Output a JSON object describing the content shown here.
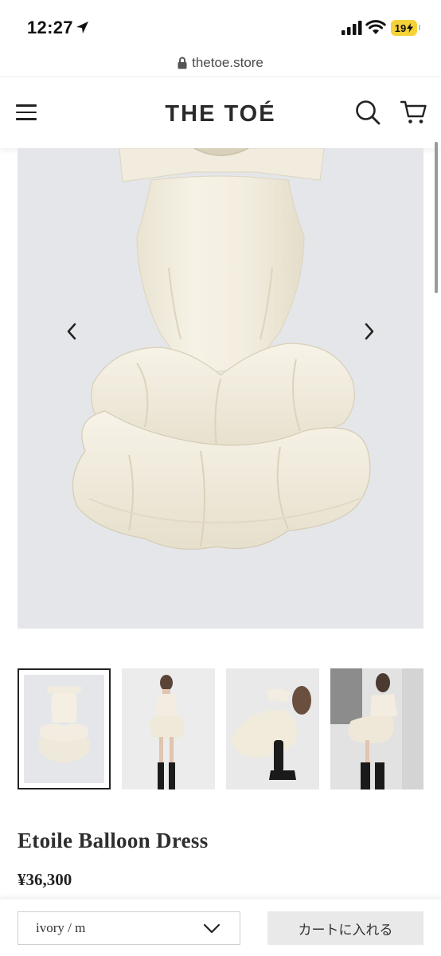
{
  "status_bar": {
    "time": "12:27",
    "battery_level": "19"
  },
  "browser": {
    "url": "thetoe.store"
  },
  "header": {
    "logo": "THE TOÉ",
    "menu_icon": "hamburger-menu-icon",
    "search_icon": "search-icon",
    "cart_icon": "cart-icon"
  },
  "gallery": {
    "prev_icon": "chevron-left-icon",
    "next_icon": "chevron-right-icon",
    "background": "#e4e6e9",
    "thumbnails_count": 4,
    "active_thumbnail": 1
  },
  "product": {
    "title": "Etoile Balloon Dress",
    "price": "¥36,300"
  },
  "purchase": {
    "variant": "ivory / m",
    "add_to_cart": "カートに入れる"
  },
  "colors": {
    "dress": "#f3eedf",
    "battery": "#f5d236",
    "button_bg": "#e9e9e9"
  }
}
